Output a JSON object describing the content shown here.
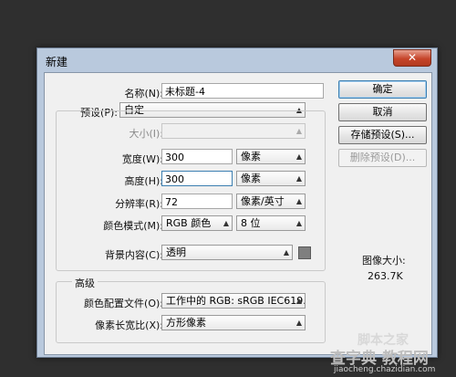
{
  "dialog": {
    "title": "新建",
    "close_symbol": "✕",
    "name_label": "名称(N):",
    "name_value": "未标题-4",
    "preset_label": "预设(P):",
    "preset_value": "自定",
    "size_label": "大小(I):",
    "size_value": "",
    "width_label": "宽度(W):",
    "width_value": "300",
    "width_unit": "像素",
    "height_label": "高度(H):",
    "height_value": "300",
    "height_unit": "像素",
    "resolution_label": "分辨率(R):",
    "resolution_value": "72",
    "resolution_unit": "像素/英寸",
    "color_mode_label": "颜色模式(M):",
    "color_mode_value": "RGB 颜色",
    "bit_depth_value": "8 位",
    "background_label": "背景内容(C):",
    "background_value": "透明",
    "advanced_label": "高级",
    "color_profile_label": "颜色配置文件(O):",
    "color_profile_value": "工作中的 RGB: sRGB IEC619...",
    "pixel_aspect_label": "像素长宽比(X):",
    "pixel_aspect_value": "方形像素",
    "image_size_label": "图像大小:",
    "image_size_value": "263.7K"
  },
  "buttons": {
    "ok": "确定",
    "cancel": "取消",
    "save_preset": "存储预设(S)...",
    "delete_preset": "删除预设(D)..."
  },
  "watermark": {
    "line1": "查字典 教程网",
    "line2": "jiaocheng.chazidian.com",
    "line3": "脚本之家"
  },
  "colors": {
    "frame": "#b9c9dd",
    "client": "#f0f0f0",
    "desktop": "#2f2f2f",
    "close": "#c6452a",
    "focus": "#3c7fb1"
  }
}
